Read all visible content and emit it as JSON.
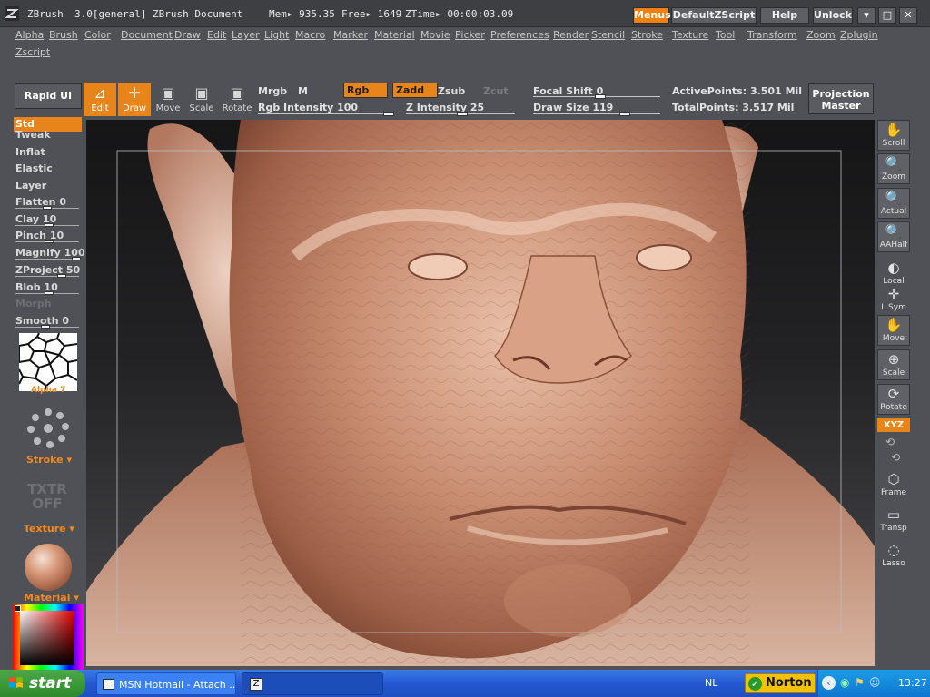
{
  "titlebar": {
    "app": "ZBrush",
    "version": "3.0[general]",
    "document": "ZBrush Document",
    "mem": "Mem▸ 935.35",
    "free": "Free▸ 1649",
    "ztime": "ZTime▸ 00:00:03.09",
    "buttons": [
      "Menus",
      "DefaultZScript",
      "Help",
      "Unlock"
    ],
    "window_buttons": [
      "▾",
      "□",
      "✕"
    ]
  },
  "menus": [
    "Alpha",
    "Brush",
    "Color",
    "Document",
    "Draw",
    "Edit",
    "Layer",
    "Light",
    "Macro",
    "Marker",
    "Material",
    "Movie",
    "Picker",
    "Preferences",
    "Render",
    "Stencil",
    "Stroke",
    "Texture",
    "Tool",
    "Transform",
    "Zoom",
    "Zplugin",
    "Zscript"
  ],
  "toolbar": {
    "rapid_ui": "Rapid UI",
    "edit": "Edit",
    "draw": "Draw",
    "move": "Move",
    "scale": "Scale",
    "rotate": "Rotate",
    "mrgb": "Mrgb",
    "m": "M",
    "rgb": "Rgb",
    "zadd": "Zadd",
    "zsub": "Zsub",
    "zcut": "Zcut",
    "rgb_intensity": "Rgb  Intensity 100",
    "z_intensity": "Z  Intensity 25",
    "focal_shift": "Focal  Shift 0",
    "draw_size": "Draw  Size 119",
    "active_points": "ActivePoints: 3.501  Mil",
    "total_points": "TotalPoints: 3.517  Mil",
    "projection_master": "Projection Master",
    "rgb_intensity_value": 100,
    "z_intensity_value": 25,
    "focal_shift_value": 0,
    "draw_size_value": 119
  },
  "brushes": {
    "selected": "Std",
    "items": [
      "Tweak",
      "Inflat",
      "Elastic",
      "Layer"
    ],
    "sliders": [
      {
        "label": "Flatten 0",
        "value": 0
      },
      {
        "label": "Clay 10",
        "value": 10
      },
      {
        "label": "Pinch 10",
        "value": 10
      },
      {
        "label": "Magnify 100",
        "value": 100
      },
      {
        "label": "ZProject 50",
        "value": 50
      },
      {
        "label": "Blob 10",
        "value": 10
      }
    ],
    "morph": "Morph",
    "smooth": "Smooth 0",
    "alpha_label": "Alpha 7",
    "stroke_label": "Stroke",
    "txtr": "TXTR",
    "txtr_off": "OFF",
    "texture_label": "Texture",
    "material_label": "Material"
  },
  "right_tools": [
    "Scroll",
    "Zoom",
    "Actual",
    "AAHalf",
    "Local",
    "L.Sym",
    "Move",
    "Scale",
    "Rotate",
    "XYZ",
    "Frame",
    "Transp",
    "Lasso"
  ],
  "taskbar": {
    "start": "start",
    "task1": "MSN Hotmail - Attach ...",
    "lang": "NL",
    "norton": "Norton",
    "clock": "13:27"
  },
  "colors": {
    "accent": "#e8851a",
    "panel": "#505157",
    "taskbar": "#245edc"
  }
}
